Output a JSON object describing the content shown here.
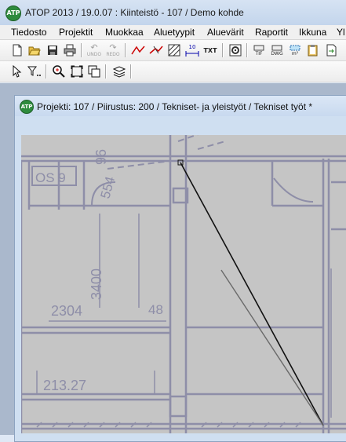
{
  "window": {
    "icon_text": "ATP",
    "title": "ATOP 2013 / 19.0.07 : Kiinteistö - 107 / Demo kohde"
  },
  "menu": [
    "Tiedosto",
    "Projektit",
    "Muokkaa",
    "Aluetyypit",
    "Aluevärit",
    "Raportit",
    "Ikkuna",
    "Yl"
  ],
  "toolbar1": {
    "undo_label": "UNDO",
    "redo_label": "REDO",
    "dim_label": "10",
    "txt_label": "TXT",
    "tif_label": "TIF",
    "dwg_label": "DWG",
    "area_label": "m²"
  },
  "document": {
    "icon_text": "ATP",
    "title": "Projekti: 107 / Piirustus: 200 / Tekniset- ja yleistyöt / Tekniset työt *"
  },
  "drawing": {
    "labels": [
      "OS 9",
      "96",
      "554",
      "3400",
      "2304",
      "48",
      "213.27"
    ]
  }
}
